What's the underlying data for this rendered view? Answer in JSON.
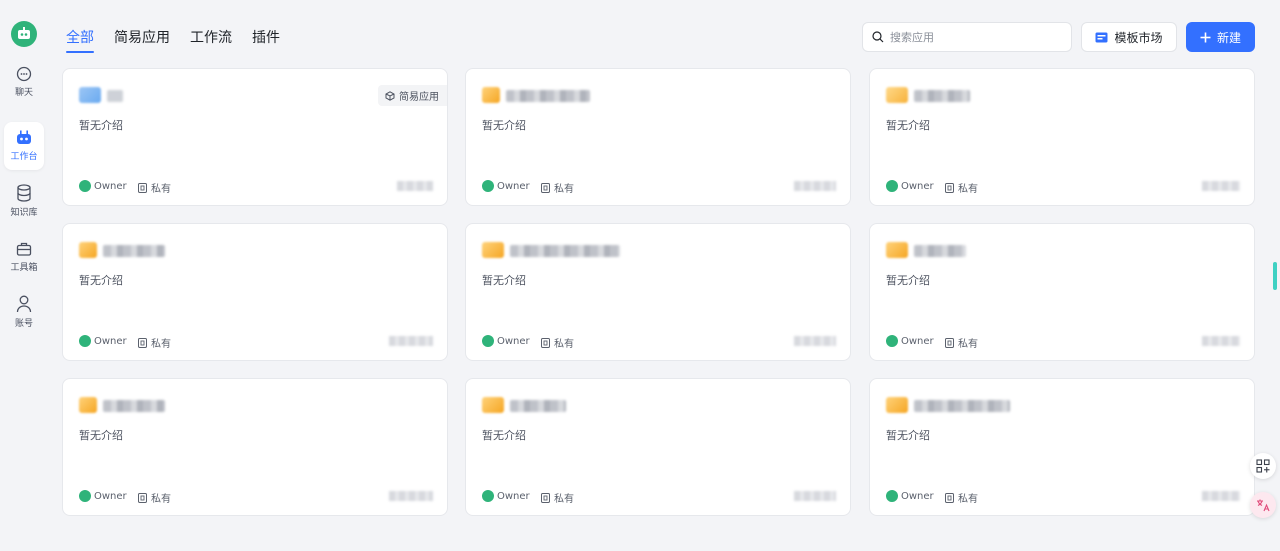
{
  "sidebar": {
    "items": [
      {
        "label": "聊天",
        "icon": "chat-icon"
      },
      {
        "label": "工作台",
        "icon": "robot-icon",
        "active": true
      },
      {
        "label": "知识库",
        "icon": "database-icon"
      },
      {
        "label": "工具箱",
        "icon": "toolbox-icon"
      },
      {
        "label": "账号",
        "icon": "user-icon"
      }
    ]
  },
  "tabs": [
    {
      "label": "全部",
      "active": true
    },
    {
      "label": "简易应用"
    },
    {
      "label": "工作流"
    },
    {
      "label": "插件"
    }
  ],
  "search": {
    "placeholder": "搜索应用"
  },
  "toolbar": {
    "market_label": "模板市场",
    "new_label": "新建"
  },
  "colors": {
    "accent": "#3370ff",
    "brand_green": "#2fb37a",
    "folder": "#f5a623"
  },
  "cards": [
    {
      "desc": "暂无介绍",
      "owner": "Owner",
      "visibility": "私有",
      "badge": "简易应用"
    },
    {
      "desc": "暂无介绍",
      "owner": "Owner",
      "visibility": "私有"
    },
    {
      "desc": "暂无介绍",
      "owner": "Owner",
      "visibility": "私有"
    },
    {
      "desc": "暂无介绍",
      "owner": "Owner",
      "visibility": "私有"
    },
    {
      "desc": "暂无介绍",
      "owner": "Owner",
      "visibility": "私有"
    },
    {
      "desc": "暂无介绍",
      "owner": "Owner",
      "visibility": "私有"
    },
    {
      "desc": "暂无介绍",
      "owner": "Owner",
      "visibility": "私有"
    },
    {
      "desc": "暂无介绍",
      "owner": "Owner",
      "visibility": "私有"
    },
    {
      "desc": "暂无介绍",
      "owner": "Owner",
      "visibility": "私有"
    }
  ]
}
